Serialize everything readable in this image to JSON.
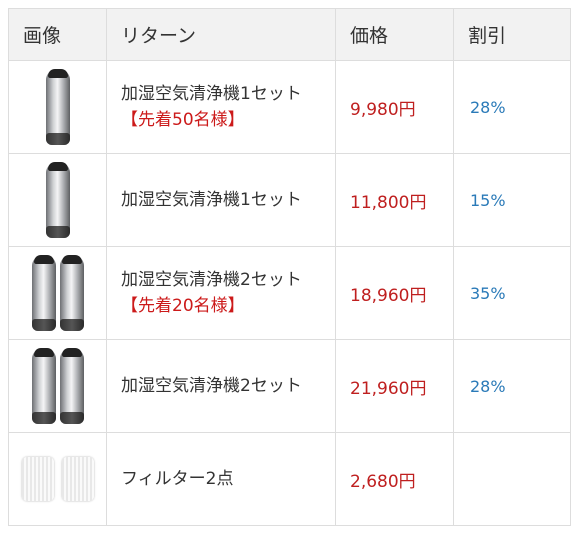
{
  "headers": {
    "image": "画像",
    "return": "リターン",
    "price": "価格",
    "discount": "割引"
  },
  "rows": [
    {
      "name": "加湿空気清浄機1セット",
      "promo": "【先着50名様】",
      "price": "9,980円",
      "discount": "28%",
      "icon": "purifier-icon"
    },
    {
      "name": "加湿空気清浄機1セット",
      "promo": "",
      "price": "11,800円",
      "discount": "15%",
      "icon": "purifier-icon"
    },
    {
      "name": "加湿空気清浄機2セット",
      "promo": "【先着20名様】",
      "price": "18,960円",
      "discount": "35%",
      "icon": "purifier-pair-icon"
    },
    {
      "name": "加湿空気清浄機2セット",
      "promo": "",
      "price": "21,960円",
      "discount": "28%",
      "icon": "purifier-pair-icon"
    },
    {
      "name": "フィルター2点",
      "promo": "",
      "price": "2,680円",
      "discount": "",
      "icon": "filter-pair-icon"
    }
  ]
}
